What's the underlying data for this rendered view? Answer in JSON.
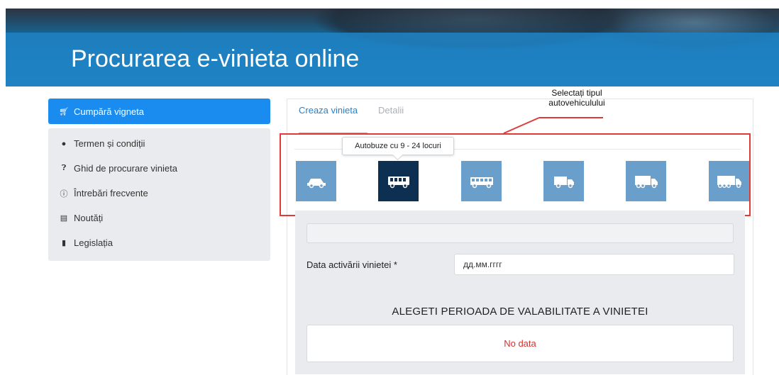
{
  "header": {
    "title": "Procurarea e-vinieta online"
  },
  "sidebar": {
    "active_item": {
      "label": "Cumpără vigneta",
      "icon": "cart-icon"
    },
    "items": [
      {
        "label": "Termen și condiții",
        "icon": "comments-icon"
      },
      {
        "label": "Ghid de procurare vinieta",
        "icon": "question-circle-icon"
      },
      {
        "label": "Întrebări frecvente",
        "icon": "info-circle-icon"
      },
      {
        "label": "Noutăți",
        "icon": "newspaper-icon"
      },
      {
        "label": "Legislația",
        "icon": "file-icon"
      }
    ]
  },
  "tabs": [
    {
      "label": "Creaza vinieta",
      "active": true
    },
    {
      "label": "Detalii",
      "active": false
    }
  ],
  "vehicles": {
    "selected_index": 1,
    "tooltip": "Autobuze cu 9 - 24 locuri",
    "items": [
      {
        "icon": "car-icon"
      },
      {
        "icon": "minibus-icon"
      },
      {
        "icon": "bus-icon"
      },
      {
        "icon": "small-truck-icon"
      },
      {
        "icon": "medium-truck-icon"
      },
      {
        "icon": "large-truck-icon"
      }
    ]
  },
  "annotation": {
    "line1": "Selectați tipul",
    "line2": "autovehiculului"
  },
  "form": {
    "date_label": "Data activării vinietei *",
    "date_placeholder": "дд.мм.гггг",
    "period_title": "ALEGETI PERIOADA DE VALABILITATE A VINIETEI",
    "no_data": "No data"
  },
  "colors": {
    "accent": "#1a8cf0",
    "vehicle_tile": "#6a9ecb",
    "vehicle_selected": "#0d2f52",
    "annotation_red": "#e03a3a",
    "no_data_red": "#d0332f"
  }
}
